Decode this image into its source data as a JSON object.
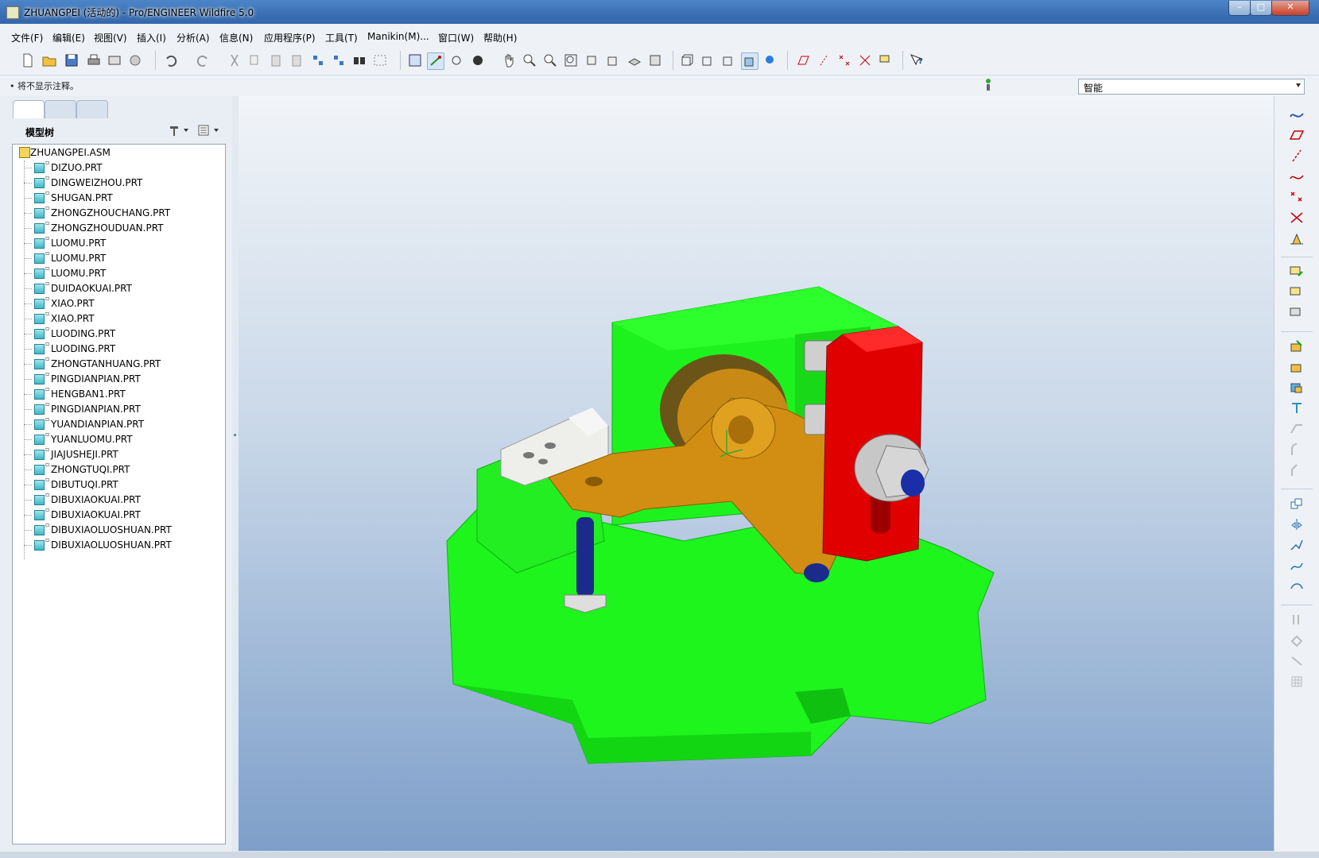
{
  "window": {
    "title": "ZHUANGPEI (活动的) - Pro/ENGINEER Wildfire 5.0",
    "minimize": "–",
    "maximize": "□",
    "close": "✕"
  },
  "menu": [
    "文件(F)",
    "编辑(E)",
    "视图(V)",
    "插入(I)",
    "分析(A)",
    "信息(N)",
    "应用程序(P)",
    "工具(T)",
    "Manikin(M)...",
    "窗口(W)",
    "帮助(H)"
  ],
  "message": "• 将不显示注释。",
  "filter": {
    "value": "智能"
  },
  "model_tree": {
    "title": "模型树",
    "root": "ZHUANGPEI.ASM",
    "items": [
      "DIZUO.PRT",
      "DINGWEIZHOU.PRT",
      "SHUGAN.PRT",
      "ZHONGZHOUCHANG.PRT",
      "ZHONGZHOUDUAN.PRT",
      "LUOMU.PRT",
      "LUOMU.PRT",
      "LUOMU.PRT",
      "DUIDAOKUAI.PRT",
      "XIAO.PRT",
      "XIAO.PRT",
      "LUODING.PRT",
      "LUODING.PRT",
      "ZHONGTANHUANG.PRT",
      "PINGDIANPIAN.PRT",
      "HENGBAN1.PRT",
      "PINGDIANPIAN.PRT",
      "YUANDIANPIAN.PRT",
      "YUANLUOMU.PRT",
      "JIAJUSHEJI.PRT",
      "ZHONGTUQI.PRT",
      "DIBUTUQI.PRT",
      "DIBUXIAOKUAI.PRT",
      "DIBUXIAOKUAI.PRT",
      "DIBUXIAOLUOSHUAN.PRT",
      "DIBUXIAOLUOSHUAN.PRT"
    ]
  },
  "colors": {
    "base": "#1aff1a",
    "bracket": "#c98a12",
    "clamp": "#e60000",
    "bolt": "#1a2b8c"
  }
}
